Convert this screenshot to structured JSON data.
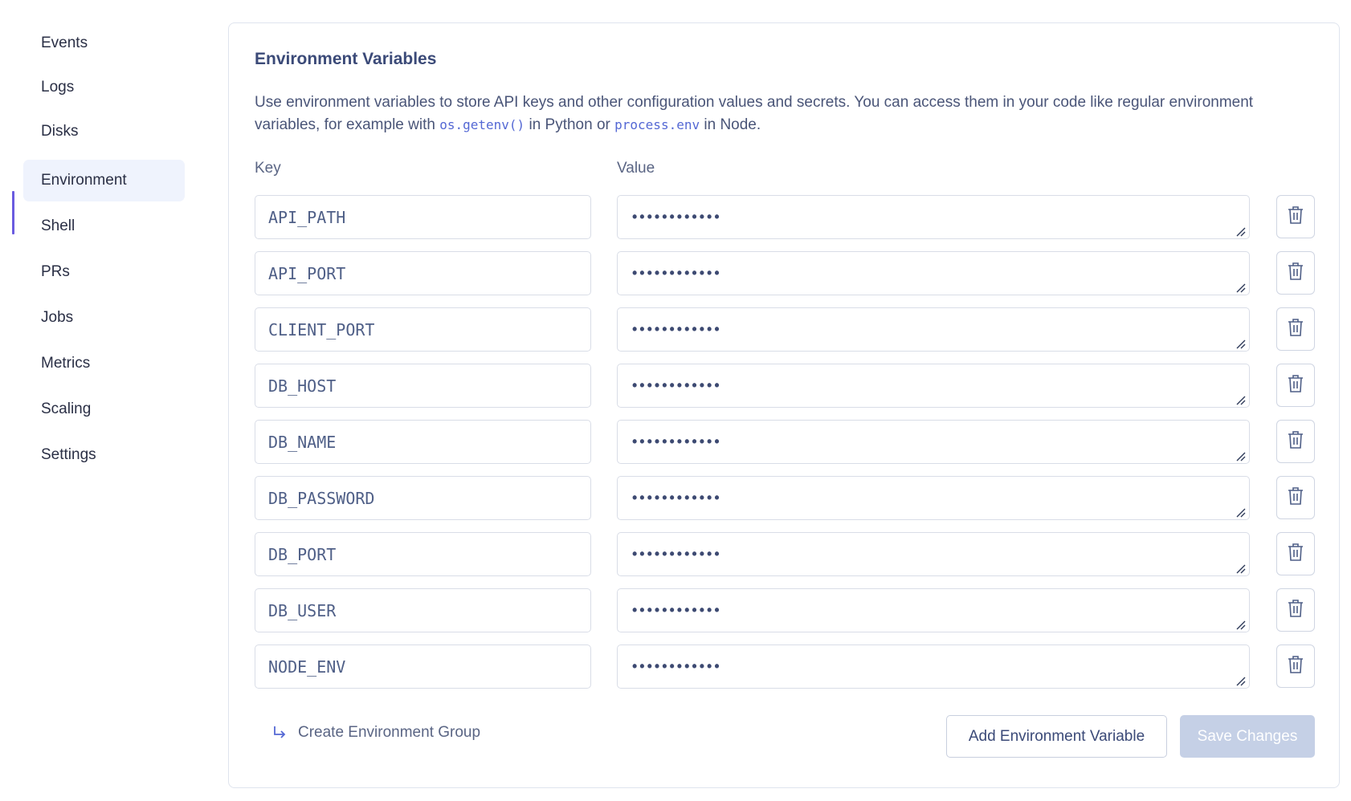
{
  "sidebar": {
    "items": [
      {
        "label": "Events",
        "name": "events"
      },
      {
        "label": "Logs",
        "name": "logs"
      },
      {
        "label": "Disks",
        "name": "disks"
      },
      {
        "label": "Environment",
        "name": "environment",
        "active": true
      },
      {
        "label": "Shell",
        "name": "shell"
      },
      {
        "label": "PRs",
        "name": "prs"
      },
      {
        "label": "Jobs",
        "name": "jobs"
      },
      {
        "label": "Metrics",
        "name": "metrics"
      },
      {
        "label": "Scaling",
        "name": "scaling"
      },
      {
        "label": "Settings",
        "name": "settings"
      }
    ],
    "accent_color": "#6a5be0",
    "active_bg": "#eff3fd"
  },
  "env": {
    "title": "Environment Variables",
    "description_parts": {
      "pre": "Use environment variables to store API keys and other configuration values and secrets. You can access them in your code like regular environment variables, for example with ",
      "code1": "os.getenv()",
      "mid": " in Python or ",
      "code2": "process.env",
      "post": " in Node."
    },
    "key_label": "Key",
    "value_label": "Value",
    "variables": [
      {
        "key": "API_PATH",
        "value": "••••••••••••"
      },
      {
        "key": "API_PORT",
        "value": "••••••••••••"
      },
      {
        "key": "CLIENT_PORT",
        "value": "••••••••••••"
      },
      {
        "key": "DB_HOST",
        "value": "••••••••••••"
      },
      {
        "key": "DB_NAME",
        "value": "••••••••••••"
      },
      {
        "key": "DB_PASSWORD",
        "value": "••••••••••••"
      },
      {
        "key": "DB_PORT",
        "value": "••••••••••••"
      },
      {
        "key": "DB_USER",
        "value": "••••••••••••"
      },
      {
        "key": "NODE_ENV",
        "value": "••••••••••••"
      }
    ],
    "delete_icon": "trash-icon",
    "create_group_label": "Create Environment Group",
    "create_group_icon": "return-arrow-icon",
    "add_button_label": "Add Environment Variable",
    "save_button_label": "Save Changes",
    "save_button_disabled": true,
    "save_button_color": "#c5d0e6"
  }
}
